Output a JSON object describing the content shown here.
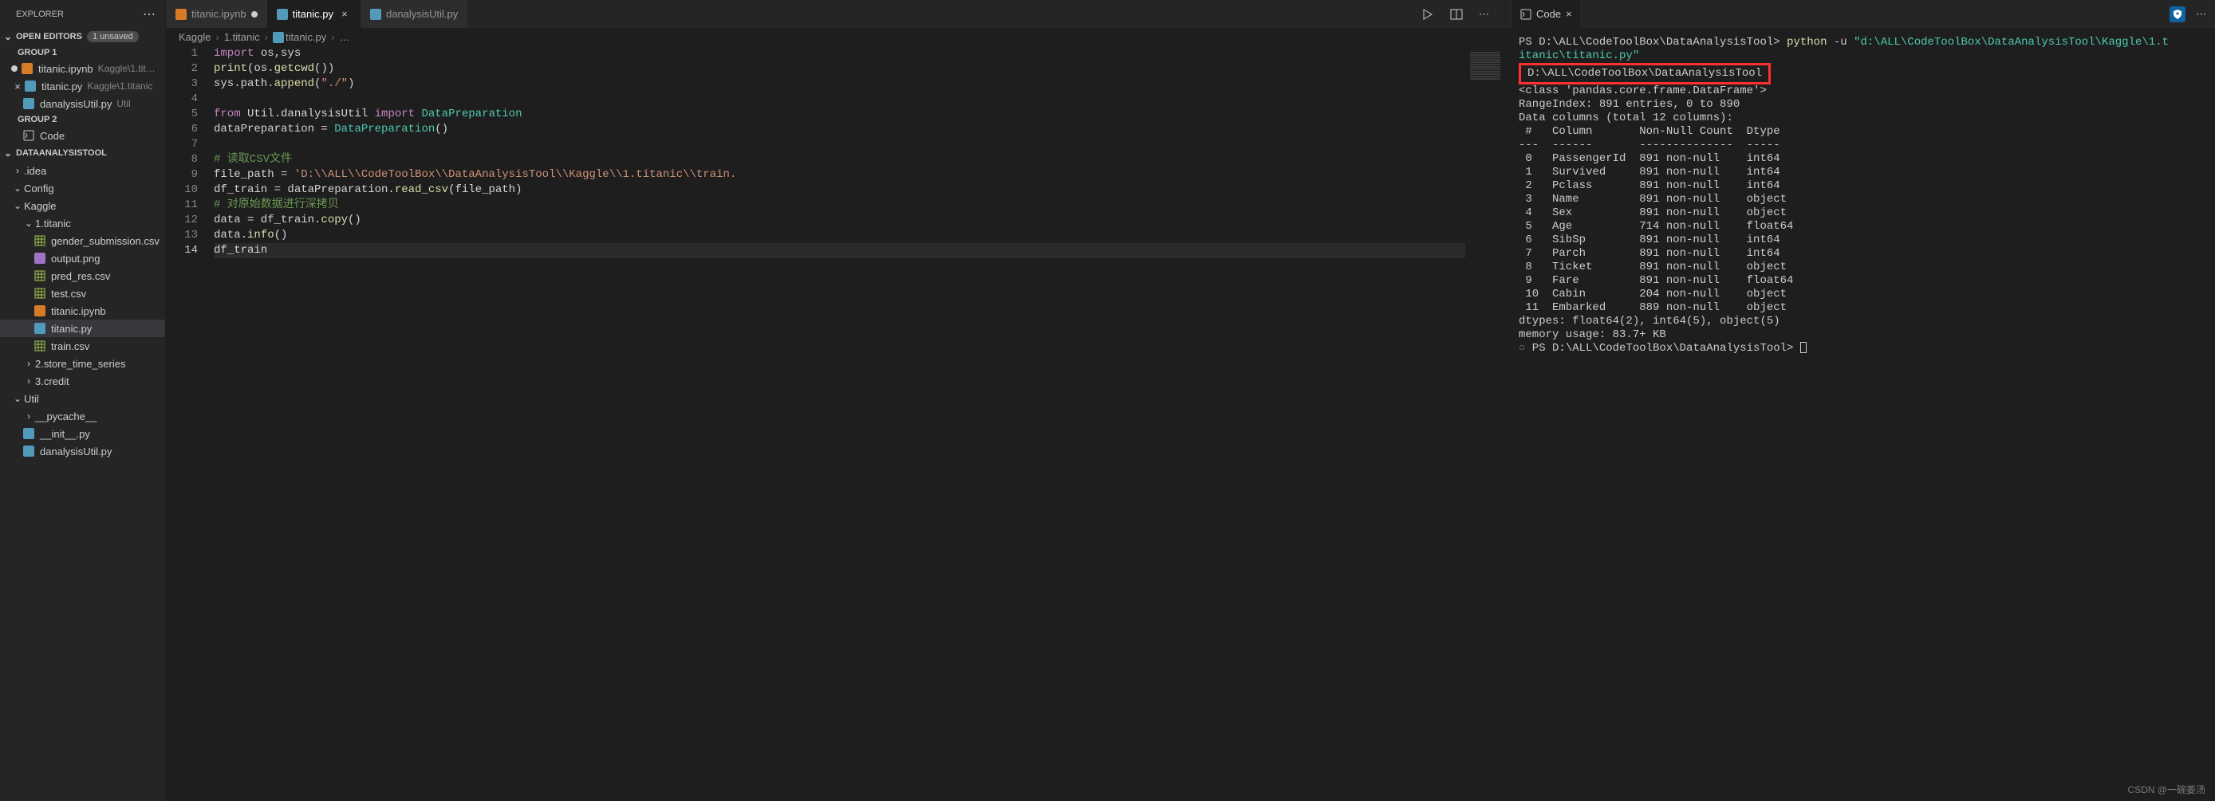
{
  "sidebar": {
    "title": "EXPLORER",
    "openEditors": {
      "label": "OPEN EDITORS",
      "badge": "1 unsaved",
      "groups": [
        "GROUP 1",
        "GROUP 2"
      ],
      "items": [
        {
          "name": "titanic.ipynb",
          "path": "Kaggle\\1.tit…",
          "dirty": true
        },
        {
          "name": "titanic.py",
          "path": "Kaggle\\1.titanic"
        },
        {
          "name": "danalysisUtil.py",
          "path": "Util"
        }
      ],
      "group2Items": [
        {
          "name": "Code"
        }
      ]
    },
    "workspace": {
      "label": "DATAANALYSISTOOL",
      "folders": [
        {
          "name": ".idea",
          "open": false,
          "indent": 1
        },
        {
          "name": "Config",
          "open": true,
          "indent": 1
        },
        {
          "name": "Kaggle",
          "open": true,
          "indent": 1
        },
        {
          "name": "1.titanic",
          "open": true,
          "indent": 2
        }
      ],
      "titanicFiles": [
        {
          "name": "gender_submission.csv",
          "type": "csv"
        },
        {
          "name": "output.png",
          "type": "img"
        },
        {
          "name": "pred_res.csv",
          "type": "csv"
        },
        {
          "name": "test.csv",
          "type": "csv"
        },
        {
          "name": "titanic.ipynb",
          "type": "nb"
        },
        {
          "name": "titanic.py",
          "type": "py",
          "active": true
        },
        {
          "name": "train.csv",
          "type": "csv"
        }
      ],
      "kaggleRest": [
        {
          "name": "2.store_time_series",
          "indent": 2
        },
        {
          "name": "3.credit",
          "indent": 2
        }
      ],
      "util": {
        "name": "Util",
        "children": [
          {
            "name": "__pycache__",
            "indent": 2,
            "folder": true
          },
          {
            "name": "__init__.py",
            "indent": 2,
            "type": "py"
          },
          {
            "name": "danalysisUtil.py",
            "indent": 2,
            "type": "py"
          }
        ]
      }
    }
  },
  "editorTabs": [
    {
      "name": "titanic.ipynb",
      "dirty": true,
      "type": "nb"
    },
    {
      "name": "titanic.py",
      "active": true,
      "type": "py"
    },
    {
      "name": "danalysisUtil.py",
      "type": "py"
    }
  ],
  "breadcrumb": [
    "Kaggle",
    "1.titanic",
    "titanic.py",
    "…"
  ],
  "code": {
    "lines": [
      [
        [
          "kw",
          "import"
        ],
        [
          "punc",
          " os,sys"
        ]
      ],
      [
        [
          "fn",
          "print"
        ],
        [
          "punc",
          "(os."
        ],
        [
          "fn",
          "getcwd"
        ],
        [
          "punc",
          "())"
        ]
      ],
      [
        [
          "punc",
          "sys.path."
        ],
        [
          "fn",
          "append"
        ],
        [
          "punc",
          "("
        ],
        [
          "str",
          "\"./\""
        ],
        [
          "punc",
          ")"
        ]
      ],
      [],
      [
        [
          "kw",
          "from"
        ],
        [
          "punc",
          " Util.danalysisUtil "
        ],
        [
          "kw",
          "import"
        ],
        [
          "punc",
          " "
        ],
        [
          "cls",
          "DataPreparation"
        ]
      ],
      [
        [
          "punc",
          "dataPreparation = "
        ],
        [
          "cls",
          "DataPreparation"
        ],
        [
          "punc",
          "()"
        ]
      ],
      [],
      [
        [
          "cmt",
          "# 读取CSV文件"
        ]
      ],
      [
        [
          "punc",
          "file_path = "
        ],
        [
          "str",
          "'D:\\\\ALL\\\\CodeToolBox\\\\DataAnalysisTool\\\\Kaggle\\\\1.titanic\\\\train."
        ]
      ],
      [
        [
          "punc",
          "df_train = dataPreparation."
        ],
        [
          "fn",
          "read_csv"
        ],
        [
          "punc",
          "(file_path)"
        ]
      ],
      [
        [
          "cmt",
          "# 对原始数据进行深拷贝"
        ]
      ],
      [
        [
          "punc",
          "data = df_train."
        ],
        [
          "fn",
          "copy"
        ],
        [
          "punc",
          "()"
        ]
      ],
      [
        [
          "punc",
          "data."
        ],
        [
          "fn",
          "info"
        ],
        [
          "punc",
          "()"
        ]
      ],
      [
        [
          "punc",
          "df_train"
        ]
      ]
    ],
    "currentLine": 14
  },
  "panel": {
    "tabLabel": "Code",
    "terminal": {
      "promptPath": "PS D:\\ALL\\CodeToolBox\\DataAnalysisTool>",
      "cmd1a": "python",
      "cmd1b": " -u ",
      "cmd1c": "\"d:\\ALL\\CodeToolBox\\DataAnalysisTool\\Kaggle\\1.t",
      "cmd1cont": "itanic\\titanic.py\"",
      "boxedPath": "D:\\ALL\\CodeToolBox\\DataAnalysisTool",
      "classLine": "<class 'pandas.core.frame.DataFrame'>",
      "rangeLine": "RangeIndex: 891 entries, 0 to 890",
      "colsHeader": "Data columns (total 12 columns):",
      "tableHeader": " #   Column       Non-Null Count  Dtype  ",
      "tableDivider": "---  ------       --------------  -----  ",
      "rows": [
        " 0   PassengerId  891 non-null    int64  ",
        " 1   Survived     891 non-null    int64  ",
        " 2   Pclass       891 non-null    int64  ",
        " 3   Name         891 non-null    object ",
        " 4   Sex          891 non-null    object ",
        " 5   Age          714 non-null    float64",
        " 6   SibSp        891 non-null    int64  ",
        " 7   Parch        891 non-null    int64  ",
        " 8   Ticket       891 non-null    object ",
        " 9   Fare         891 non-null    float64",
        " 10  Cabin        204 non-null    object ",
        " 11  Embarked     889 non-null    object "
      ],
      "dtypesLine": "dtypes: float64(2), int64(5), object(5)",
      "memLine": "memory usage: 83.7+ KB",
      "lastPrompt": "PS D:\\ALL\\CodeToolBox\\DataAnalysisTool>"
    }
  },
  "watermark": "CSDN @一碗姜汤"
}
